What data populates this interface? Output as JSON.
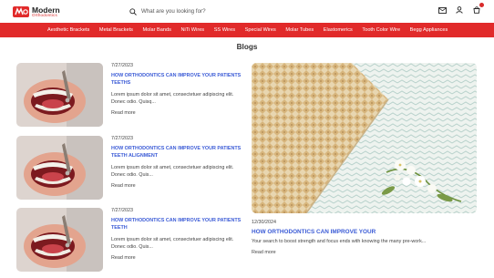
{
  "brand": {
    "name": "Modern",
    "tagline": "Orthodontics",
    "accent_color": "#e12a2a",
    "link_color": "#3b5bd6"
  },
  "search": {
    "placeholder": "What are you looking for?"
  },
  "header_icons": [
    "search-icon",
    "mail-icon",
    "user-icon",
    "cart-icon"
  ],
  "nav": {
    "items": [
      {
        "label": "Aesthetic Brackets"
      },
      {
        "label": "Metal Brackets"
      },
      {
        "label": "Molar Bands"
      },
      {
        "label": "NiTi Wires"
      },
      {
        "label": "SS Wires"
      },
      {
        "label": "Special Wires"
      },
      {
        "label": "Molar Tubes"
      },
      {
        "label": "Elastomerics"
      },
      {
        "label": "Tooth Color Wire"
      },
      {
        "label": "Begg Appliances"
      }
    ]
  },
  "page": {
    "title": "Blogs"
  },
  "posts": [
    {
      "date": "7/27/2023",
      "title": "HOW ORTHODONTICS CAN IMPROVE YOUR PATIENTS TEETHS",
      "excerpt": "Lorem ipsum dolor sit amet, consectetuer adipiscing elit. Donec odio. Quisq...",
      "read_more": "Read more"
    },
    {
      "date": "7/27/2023",
      "title": "HOW ORTHODONTICS CAN IMPROVE YOUR PATIENTS TEETH ALIGNMENT",
      "excerpt": "Lorem ipsum dolor sit amet, consectetuer adipiscing elit. Donec odio. Quis...",
      "read_more": "Read more"
    },
    {
      "date": "7/27/2023",
      "title": "HOW ORTHODONTICS CAN IMPROVE YOUR PATIENTS TEETH",
      "excerpt": "Lorem ipsum dolor sit amet, consectetuer adipiscing elit. Donec odio. Quis...",
      "read_more": "Read more"
    }
  ],
  "featured": {
    "date": "12/30/2024",
    "title": "HOW ORTHODONTICS CAN IMPROVE YOUR",
    "excerpt": "Your search to boost strength and focus ends with knowing the many pre-work...",
    "read_more": "Read more"
  }
}
